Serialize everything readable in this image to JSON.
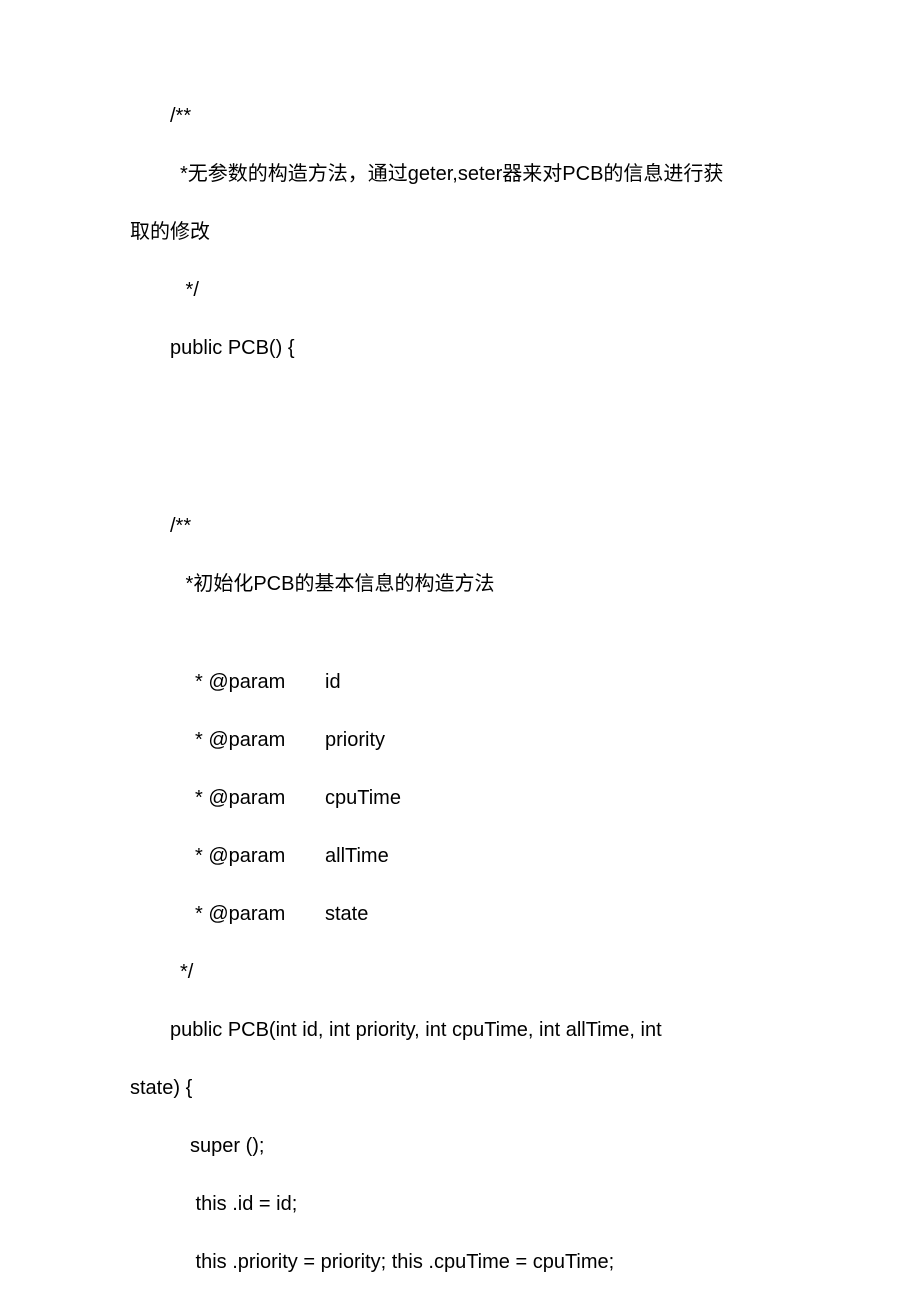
{
  "block1": {
    "open": "/**",
    "desc_line1": " *无参数的构造方法，通过geter,seter器来对PCB的信息进行获",
    "desc_line2": "取的修改",
    "close": " */",
    "ctor": "public PCB() {"
  },
  "block2": {
    "open": "/**",
    "desc": " *初始化PCB的基本信息的构造方法",
    "params": [
      {
        "tag": "* @param",
        "name": "id"
      },
      {
        "tag": "* @param",
        "name": "priority"
      },
      {
        "tag": "* @param",
        "name": "cpuTime"
      },
      {
        "tag": "* @param",
        "name": "allTime"
      },
      {
        "tag": "* @param",
        "name": "state"
      }
    ],
    "close": "*/",
    "ctor_line1": "public PCB(int id, int priority, int cpuTime, int allTime, int",
    "ctor_line2": "state) {",
    "body1": "super ();",
    "body2": " this .id = id;",
    "body3": " this .priority = priority; this .cpuTime = cpuTime;"
  }
}
